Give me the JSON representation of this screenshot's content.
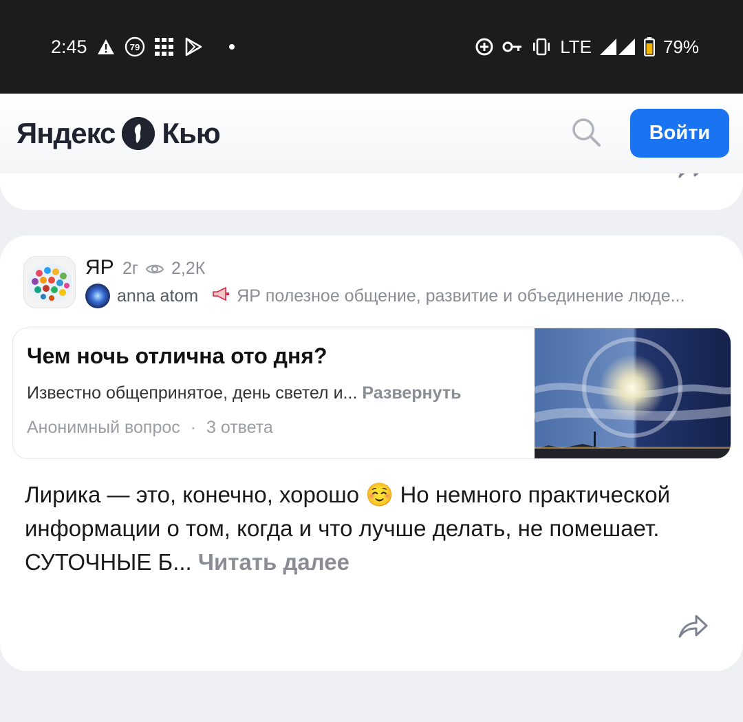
{
  "status_bar": {
    "time": "2:45",
    "notification_badge": "79",
    "network": "LTE",
    "battery": "79%",
    "icons": [
      "alert-icon",
      "badge-79-icon",
      "grid-icon",
      "play-store-icon",
      "dot-icon",
      "data-saver-icon",
      "vpn-key-icon",
      "vibrate-icon",
      "signal-icon",
      "battery-icon"
    ]
  },
  "header": {
    "logo_text_1": "Яндекс",
    "logo_text_2": "Кью",
    "search_icon": "search-icon",
    "login_label": "Войти",
    "accent": "#1a73f0"
  },
  "card": {
    "community_name": "ЯР",
    "age": "2г",
    "views": "2,2К",
    "author_name": "anna atom",
    "community_description": "ЯР полезное общение, развитие и объединение люде...",
    "question": {
      "title": "Чем ночь отлична ото дня?",
      "excerpt": "Известно общепринятое, день светел и...",
      "expand_label": "Развернуть",
      "asker": "Анонимный вопрос",
      "separator": "·",
      "answers_count": "3 ответа"
    },
    "answer": {
      "text": "Лирика — это, конечно, хорошо ☺️ Но немного практической информации о том, когда и что лучше делать, не помешает. СУТОЧНЫЕ Б...",
      "read_more_label": "Читать далее"
    }
  }
}
